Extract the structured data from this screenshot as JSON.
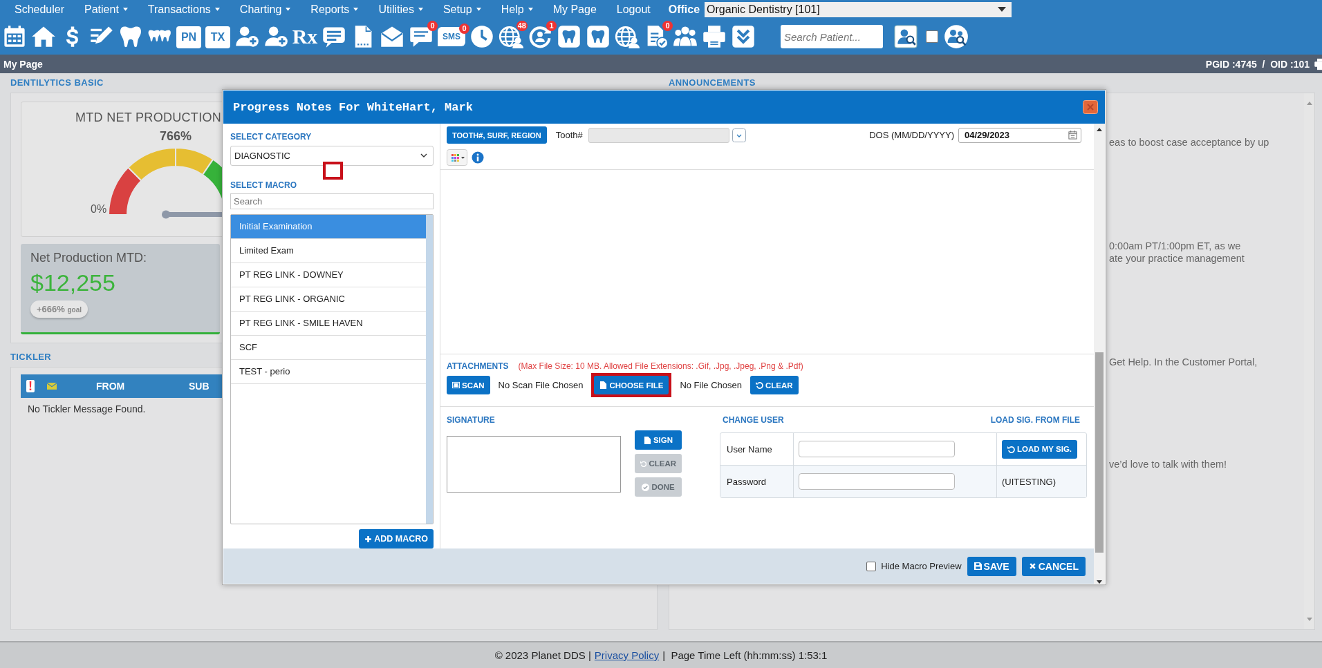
{
  "menu": {
    "items": [
      {
        "label": "Scheduler",
        "dropdown": false
      },
      {
        "label": "Patient",
        "dropdown": true
      },
      {
        "label": "Transactions",
        "dropdown": true
      },
      {
        "label": "Charting",
        "dropdown": true
      },
      {
        "label": "Reports",
        "dropdown": true
      },
      {
        "label": "Utilities",
        "dropdown": true
      },
      {
        "label": "Setup",
        "dropdown": true
      },
      {
        "label": "Help",
        "dropdown": true
      },
      {
        "label": "My Page",
        "dropdown": false
      },
      {
        "label": "Logout",
        "dropdown": false
      }
    ],
    "office_label": "Office",
    "office_value": "Organic Dentistry [101]"
  },
  "toolbar": {
    "items": [
      {
        "kind": "calendar"
      },
      {
        "kind": "home"
      },
      {
        "kind": "dollar"
      },
      {
        "kind": "pencil"
      },
      {
        "kind": "tooth"
      },
      {
        "kind": "teeth"
      },
      {
        "kind": "tile",
        "label": "PN"
      },
      {
        "kind": "tile",
        "label": "TX"
      },
      {
        "kind": "userplus"
      },
      {
        "kind": "userplus"
      },
      {
        "kind": "rx",
        "label": "Rx"
      },
      {
        "kind": "chatlines"
      },
      {
        "kind": "document"
      },
      {
        "kind": "envelope"
      },
      {
        "kind": "chat",
        "badge": "0"
      },
      {
        "kind": "bubble",
        "label": "SMS",
        "badge": "0"
      },
      {
        "kind": "clock"
      },
      {
        "kind": "globe",
        "badge": "48"
      },
      {
        "kind": "refresh",
        "badge": "1"
      },
      {
        "kind": "toothbox"
      },
      {
        "kind": "toothbox"
      },
      {
        "kind": "globe"
      },
      {
        "kind": "doccheck",
        "badge": "0"
      },
      {
        "kind": "people"
      },
      {
        "kind": "printer"
      },
      {
        "kind": "chevron"
      }
    ],
    "search_placeholder": "Search Patient...",
    "checkbox_checked": false
  },
  "page_bar": {
    "title": "My Page",
    "ids": "PGID :4745  /  OID :101"
  },
  "dentilytics": {
    "heading": "DENTILYTICS BASIC",
    "gauge": {
      "title": "MTD NET PRODUCTION",
      "percent": "766%",
      "min_label": "0%"
    },
    "net_production": {
      "label": "Net Production MTD:",
      "value": "$12,255",
      "badge_value": "+666%",
      "badge_label": "goal"
    }
  },
  "tickler": {
    "heading": "TICKLER",
    "columns": [
      {
        "kind": "priority",
        "label": "!"
      },
      {
        "kind": "mail"
      },
      {
        "kind": "text",
        "label": "FROM"
      },
      {
        "kind": "text",
        "label": "SUB"
      }
    ],
    "empty": "No Tickler Message Found."
  },
  "announcements": {
    "heading": "ANNOUNCEMENTS",
    "paragraphs": [
      [
        "eas to boost case acceptance by up"
      ],
      [
        "0:00am PT/1:00pm ET, as we",
        "ate your practice management"
      ],
      [
        "Get Help. In the Customer Portal,"
      ],
      [
        "ve’d love to talk with them!"
      ]
    ]
  },
  "footer": {
    "copyright": "© 2023 Planet DDS |",
    "link": "Privacy Policy",
    "time_left": "|  Page Time Left (hh:mm:ss) 1:53:1"
  },
  "dialog": {
    "title": "Progress Notes For WhiteHart, Mark",
    "category": {
      "label": "SELECT CATEGORY",
      "value": "DIAGNOSTIC"
    },
    "macro": {
      "label": "SELECT MACRO",
      "search_placeholder": "Search",
      "items": [
        {
          "label": "Initial Examination",
          "selected": true
        },
        {
          "label": "Limited Exam",
          "selected": false
        },
        {
          "label": "PT REG LINK - DOWNEY",
          "selected": false
        },
        {
          "label": "PT REG LINK - ORGANIC",
          "selected": false
        },
        {
          "label": "PT REG LINK - SMILE HAVEN",
          "selected": false
        },
        {
          "label": "SCF",
          "selected": false
        },
        {
          "label": "TEST - perio",
          "selected": false
        }
      ],
      "add_button": "ADD MACRO"
    },
    "markers": [
      {
        "kind": "box"
      }
    ],
    "tooth": {
      "button": "TOOTH#, SURF, REGION",
      "label": "Tooth#"
    },
    "dos": {
      "label": "DOS (MM/DD/YYYY)",
      "value": "04/29/2023"
    },
    "attachments": {
      "label": "ATTACHMENTS",
      "note": "(Max File Size: 10 MB. Allowed File Extensions: .Gif, .Jpg, .Jpeg, .Png & .Pdf)",
      "scan_button": "SCAN",
      "scan_status": "No Scan File Chosen",
      "choose_button": "CHOOSE FILE",
      "choose_highlighted": true,
      "file_status": "No File Chosen",
      "clear_button": "CLEAR"
    },
    "signature": {
      "label": "SIGNATURE",
      "buttons": [
        {
          "kind": "sign",
          "label": "SIGN",
          "disabled": false
        },
        {
          "kind": "clear",
          "label": "CLEAR",
          "disabled": true
        },
        {
          "kind": "done",
          "label": "DONE",
          "disabled": true
        }
      ]
    },
    "change_user": {
      "label": "CHANGE USER",
      "load_label": "LOAD SIG. FROM FILE",
      "rows": [
        {
          "label": "User Name",
          "kind": "button",
          "action": "LOAD MY SIG."
        },
        {
          "label": "Password",
          "kind": "text",
          "action": "(UITESTING)"
        }
      ]
    },
    "hide_preview": {
      "label": "Hide Macro Preview",
      "checked": false
    },
    "save": "SAVE",
    "cancel": "CANCEL"
  }
}
